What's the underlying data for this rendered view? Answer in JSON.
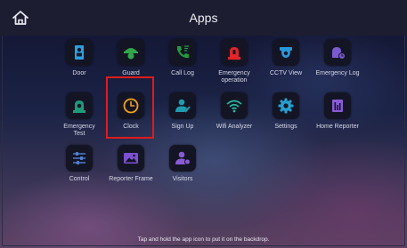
{
  "header": {
    "title": "Apps",
    "home_icon": "home-icon"
  },
  "apps": [
    {
      "label": "Door",
      "icon": "door-icon",
      "color": "#2b9fe0"
    },
    {
      "label": "Guard",
      "icon": "guard-icon",
      "color": "#2ea84a"
    },
    {
      "label": "Call Log",
      "icon": "call-log-icon",
      "color": "#1f9b3f"
    },
    {
      "label": "Emergency\noperation",
      "icon": "emergency-operation-icon",
      "color": "#e0242a"
    },
    {
      "label": "CCTV View",
      "icon": "cctv-icon",
      "color": "#2798d8"
    },
    {
      "label": "Emergency Log",
      "icon": "emergency-log-icon",
      "color": "#7b5ad1"
    },
    {
      "label": "Emergency\nTest",
      "icon": "emergency-test-icon",
      "color": "#1d9a7a"
    },
    {
      "label": "Clock",
      "icon": "clock-icon",
      "color": "#f2a21a"
    },
    {
      "label": "Sign Up",
      "icon": "sign-up-icon",
      "color": "#1f9cb0"
    },
    {
      "label": "Wifi Analyzer",
      "icon": "wifi-icon",
      "color": "#25b8a0"
    },
    {
      "label": "Settings",
      "icon": "settings-icon",
      "color": "#25a0cf"
    },
    {
      "label": "Home Reporter",
      "icon": "home-reporter-icon",
      "color": "#8a5ad6"
    },
    {
      "label": "Control",
      "icon": "control-icon",
      "color": "#5080d8"
    },
    {
      "label": "Reporter Frame",
      "icon": "reporter-frame-icon",
      "color": "#7c4fd0"
    },
    {
      "label": "Visitors",
      "icon": "visitors-icon",
      "color": "#8a5ad6"
    }
  ],
  "footer": {
    "hint": "Tap and hold the app icon to put it on the backdrop."
  },
  "colors": {
    "highlight": "#e01b1b",
    "topbar": "#1c1d31"
  }
}
